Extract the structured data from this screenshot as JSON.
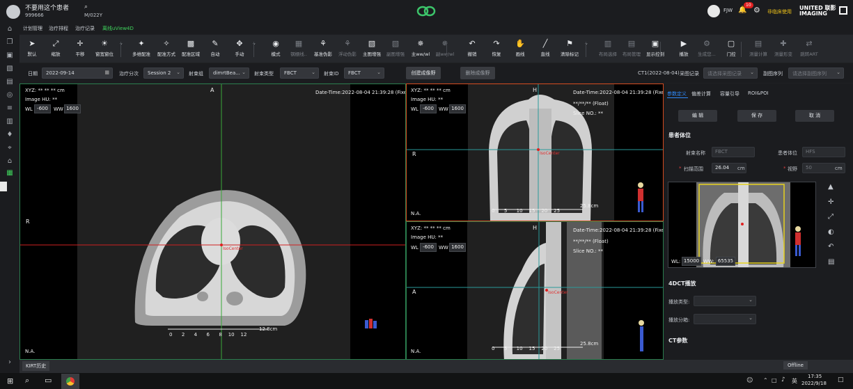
{
  "header": {
    "patient_name": "不要用这个患者",
    "patient_id": "999666",
    "patient_code": "M/022Y",
    "user": "FJW",
    "notifications": "10",
    "non_clinical": "非临床使用",
    "brand_line1": "UNITED 联影",
    "brand_line2": "IMAGING"
  },
  "menu": {
    "items": [
      "计划管理",
      "治疗排程",
      "治疗记录",
      "离线uView4D"
    ],
    "active_index": 3
  },
  "toolbar": {
    "items": [
      {
        "icon": "cursor-icon",
        "label": "默认",
        "state": "on"
      },
      {
        "icon": "zoom-icon",
        "label": "缩放",
        "state": "on"
      },
      {
        "icon": "pan-icon",
        "label": "平移",
        "state": "on"
      },
      {
        "icon": "window-level-icon",
        "label": "窗宽窗位",
        "state": "on"
      },
      {
        "icon": "multi-register-icon",
        "label": "多维配准",
        "state": "on"
      },
      {
        "icon": "register-mode-icon",
        "label": "配准方式",
        "state": "on"
      },
      {
        "icon": "register-region-icon",
        "label": "配准区域",
        "state": "on"
      },
      {
        "icon": "auto-icon",
        "label": "自动",
        "state": "on"
      },
      {
        "icon": "manual-icon",
        "label": "手动",
        "state": "on"
      },
      {
        "icon": "mode-icon",
        "label": "模式",
        "state": "on"
      },
      {
        "icon": "grid-icon",
        "label": "钢棚线..",
        "state": "off"
      },
      {
        "icon": "artifact-icon",
        "label": "基准伪影",
        "state": "on"
      },
      {
        "icon": "float-artifact-icon",
        "label": "浮动伪影",
        "state": "off"
      },
      {
        "icon": "main-enhance-icon",
        "label": "主图增强",
        "state": "on"
      },
      {
        "icon": "sub-enhance-icon",
        "label": "副图增强",
        "state": "off"
      },
      {
        "icon": "main-wwwl-icon",
        "label": "主ww/wl",
        "state": "on"
      },
      {
        "icon": "sub-wwwl-icon",
        "label": "副ww/wl",
        "state": "off"
      },
      {
        "icon": "undo-icon",
        "label": "撤销",
        "state": "on"
      },
      {
        "icon": "redo-icon",
        "label": "恢复",
        "state": "on"
      },
      {
        "icon": "hand-icon",
        "label": "画线",
        "state": "on"
      },
      {
        "icon": "line-icon",
        "label": "直线",
        "state": "on"
      },
      {
        "icon": "clear-mark-icon",
        "label": "清除标记",
        "state": "on"
      },
      {
        "icon": "layout-select-icon",
        "label": "布局选择",
        "state": "off"
      },
      {
        "icon": "layout-manage-icon",
        "label": "布局管理",
        "state": "off"
      },
      {
        "icon": "display-control-icon",
        "label": "显示控制",
        "state": "on"
      },
      {
        "icon": "play-img-icon",
        "label": "播放",
        "state": "on"
      },
      {
        "icon": "generate-icon",
        "label": "生成您...",
        "state": "off"
      },
      {
        "icon": "gate-icon",
        "label": "门控",
        "state": "on"
      },
      {
        "icon": "measure-calc-icon",
        "label": "测量计算",
        "state": "off"
      },
      {
        "icon": "measure-shape-icon",
        "label": "测量形变",
        "state": "off"
      },
      {
        "icon": "jump-art-icon",
        "label": "跳转ART",
        "state": "off"
      }
    ]
  },
  "filters": {
    "date_label": "日期",
    "date_value": "2022-09-14",
    "fraction_label": "治疗分次",
    "fraction_value": "Session 2",
    "beam_group_label": "射束组",
    "beam_group_value": "dimrtBea...",
    "beam_type_label": "射束类型",
    "beam_type_value": "FBCT",
    "beam_id_label": "射束ID",
    "beam_id_value": "FBCT",
    "create_btn": "创建成像野",
    "delete_btn": "删除成像野",
    "ct_label": "CT1(2022-08-04)",
    "collect_label": "采图记录",
    "collect_placeholder": "请选择采图记录",
    "sub_series_label": "副图序列",
    "sub_series_placeholder": "请选择副图序列"
  },
  "viewports": {
    "axial": {
      "xyz": "XYZ: ** ** ** cm",
      "hu": "Image HU:  **",
      "wl_label": "WL",
      "wl": "-600",
      "ww_label": "WW",
      "ww": "1600",
      "datetime": "Date-Time:2022-08-04 21:39:28 (Fixed)",
      "orient_top": "A",
      "orient_left": "R",
      "na": "N.A.",
      "iso": "IsoCenter",
      "scale": "12.8cm",
      "ticks": [
        "0",
        "2",
        "4",
        "6",
        "8",
        "10",
        "12"
      ]
    },
    "coronal": {
      "xyz": "XYZ: ** ** ** cm",
      "hu": "Image HU:  **",
      "wl": "-600",
      "ww": "1600",
      "datetime": "Date-Time:2022-08-04 21:39:28 (Fixed)",
      "float_text": "**/**/** (Float)",
      "slice": "Slice NO.: **",
      "orient_top": "H",
      "orient_left": "R",
      "na": "N.A.",
      "iso": "IsoCenter",
      "scale": "25.8cm",
      "ticks": [
        "0",
        "5",
        "10",
        "15",
        "20",
        "25"
      ]
    },
    "sagittal": {
      "xyz": "XYZ: ** ** ** cm",
      "hu": "Image HU:  **",
      "wl": "-600",
      "ww": "1600",
      "datetime": "Date-Time:2022-08-04 21:39:28 (Fixed)",
      "float_text": "**/**/** (Float)",
      "slice": "Slice NO.: **",
      "orient_top": "H",
      "orient_left": "A",
      "na": "N.A.",
      "iso": "IsoCenter",
      "scale": "25.8cm",
      "ticks": [
        "0",
        "5",
        "10",
        "15",
        "20",
        "25"
      ]
    }
  },
  "right_panel": {
    "tabs": [
      "参数定义",
      "偏差计算",
      "容量引导",
      "ROI&POI"
    ],
    "active_tab": 0,
    "edit_btn": "编 辑",
    "save_btn": "保 存",
    "cancel_btn": "取 消",
    "patient_pos_title": "患者体位",
    "beam_name_label": "射束名称",
    "beam_name_value": "FBCT",
    "patient_pos_label": "患者体位",
    "patient_pos_value": "HFS",
    "scan_range_label": "扫描范围",
    "scan_range_value": "26.04",
    "scan_unit": "cm",
    "fov_label": "视野",
    "fov_value": "50",
    "fov_unit": "cm",
    "mini_wl_label": "WL:",
    "mini_wl": "15000",
    "mini_ww_label": "WW:",
    "mini_ww": "65535",
    "dct_title": "4DCT播放",
    "play_type_label": "播放类型:",
    "play_phase_label": "播放分箱:",
    "ct_params_title": "CT参数"
  },
  "status": {
    "kirt": "KIRT历史",
    "offline": "Offline"
  },
  "taskbar": {
    "ime": "英",
    "time": "17:35",
    "date": "2022/9/18"
  }
}
